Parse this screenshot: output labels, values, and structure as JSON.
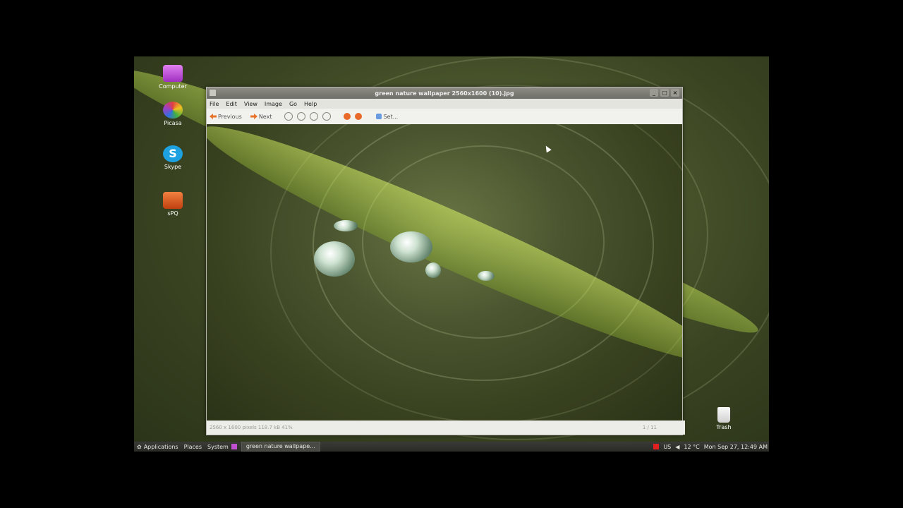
{
  "desktop": {
    "icons": [
      {
        "label": "Computer",
        "icon": "computer-icon",
        "color": "#c050d0"
      },
      {
        "label": "Picasa",
        "icon": "picasa-icon",
        "color": "#e04040"
      },
      {
        "label": "Skype",
        "icon": "skype-icon",
        "color": "#1da1e0"
      },
      {
        "label": "sPQ",
        "icon": "folder-icon",
        "color": "#e06020"
      }
    ],
    "trash_label": "Trash"
  },
  "window": {
    "title": "green nature wallpaper 2560x1600 (10).jpg",
    "controls": [
      "_",
      "□",
      "×"
    ],
    "menu": [
      "File",
      "Edit",
      "View",
      "Image",
      "Go",
      "Help"
    ],
    "toolbar": {
      "previous_label": "Previous",
      "next_label": "Next",
      "zoom_icons": [
        "zoom-in-icon",
        "zoom-out-icon",
        "zoom-normal-icon",
        "zoom-fit-icon"
      ],
      "rotate_icons": [
        "rotate-left-icon",
        "rotate-right-icon"
      ],
      "extra_label": "Set..."
    },
    "statusbar": {
      "info": "2560 x 1600 pixels  118.7 kB  41%",
      "page": "1 / 11"
    }
  },
  "panel": {
    "applications": "Applications",
    "places": "Places",
    "system": "System",
    "task": "green nature wallpape...",
    "temperature": "12 °C",
    "datetime": "Mon Sep 27, 12:49 AM",
    "locale": "US"
  }
}
